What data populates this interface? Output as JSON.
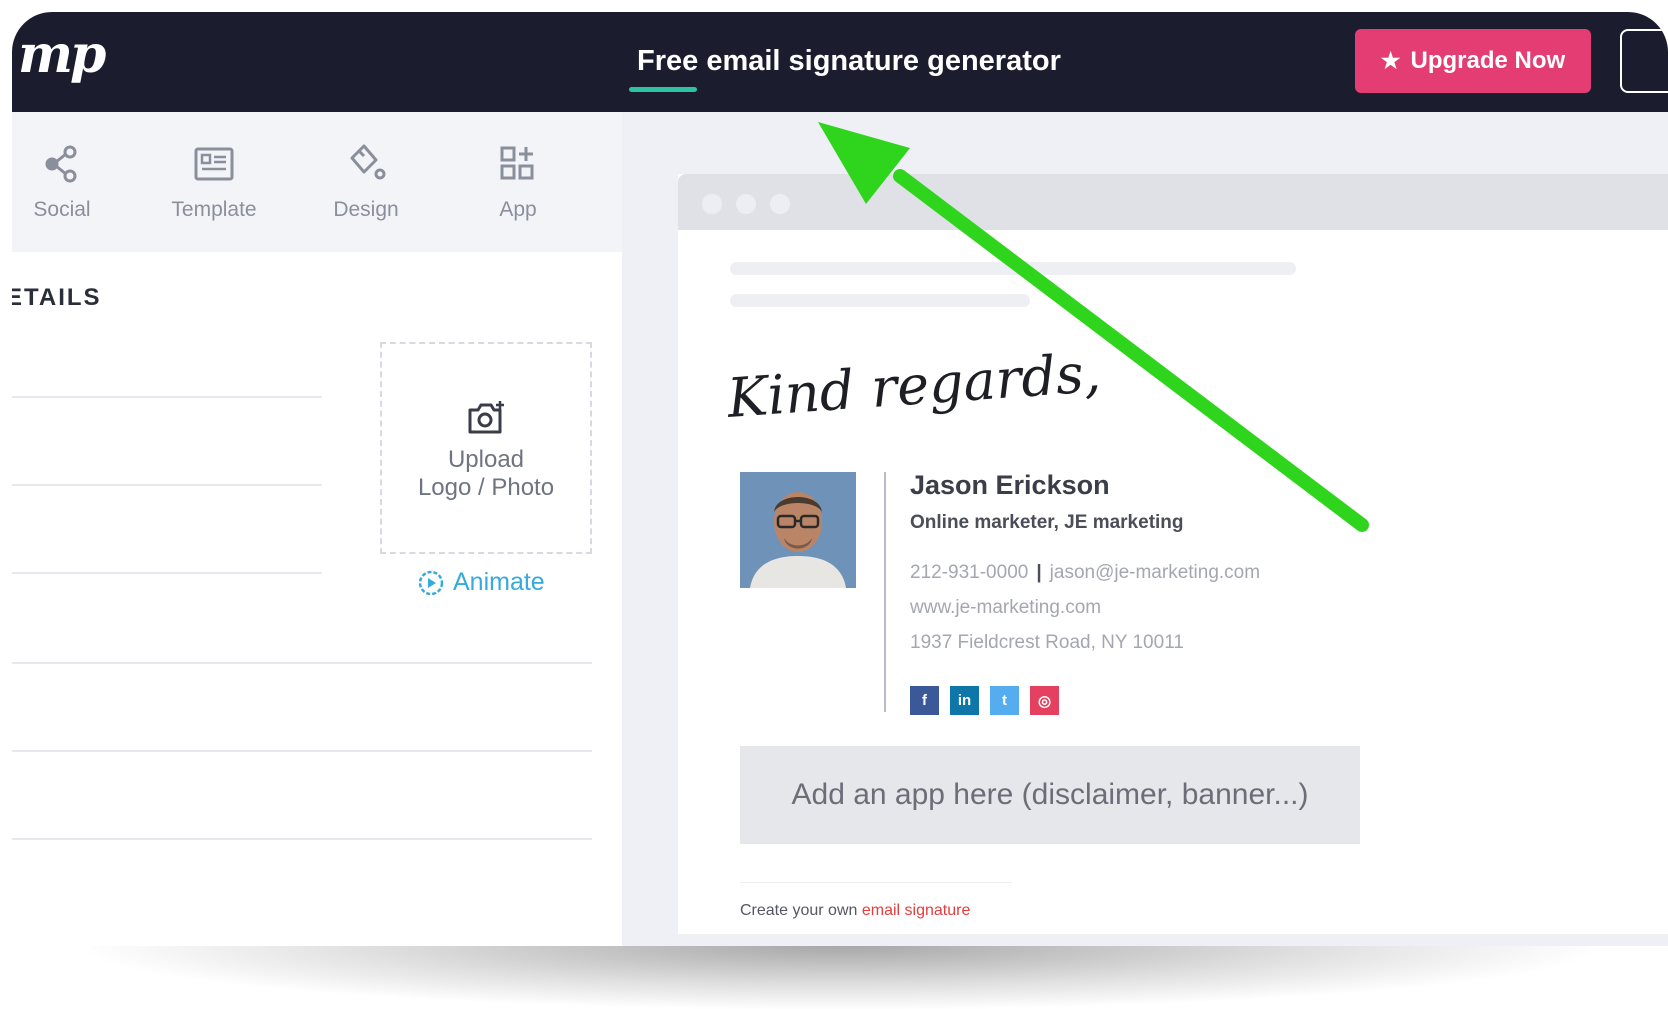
{
  "header": {
    "logo_text": "mp",
    "title": "Free email signature generator",
    "upgrade_label": "Upgrade Now"
  },
  "toolbar": {
    "items": [
      {
        "label": "Social",
        "icon": "share-icon"
      },
      {
        "label": "Template",
        "icon": "template-icon"
      },
      {
        "label": "Design",
        "icon": "paint-bucket-icon"
      },
      {
        "label": "App",
        "icon": "apps-add-icon"
      }
    ]
  },
  "details": {
    "section_title": "ETAILS",
    "upload_line1": "Upload",
    "upload_line2": "Logo / Photo",
    "animate_label": "Animate"
  },
  "signature": {
    "closing": "Kind regards,",
    "name": "Jason Erickson",
    "role": "Online marketer, JE marketing",
    "phone": "212-931-0000",
    "separator": "|",
    "email": "jason@je-marketing.com",
    "website": "www.je-marketing.com",
    "address": "1937 Fieldcrest Road, NY 10011",
    "social": [
      {
        "glyph": "f",
        "network": "facebook",
        "color": "#3b5998"
      },
      {
        "glyph": "in",
        "network": "linkedin",
        "color": "#0e76a8"
      },
      {
        "glyph": "t",
        "network": "twitter",
        "color": "#55acee"
      },
      {
        "glyph": "◎",
        "network": "instagram",
        "color": "#e4405f"
      }
    ],
    "app_placeholder": "Add an app here (disclaimer, banner...)",
    "footer_prefix": "Create your own ",
    "footer_link": "email signature"
  },
  "colors": {
    "topbar": "#1b1d2e",
    "accent_pink": "#e33d74",
    "link_blue": "#35aadc",
    "annotation_arrow": "#2fd41c"
  }
}
